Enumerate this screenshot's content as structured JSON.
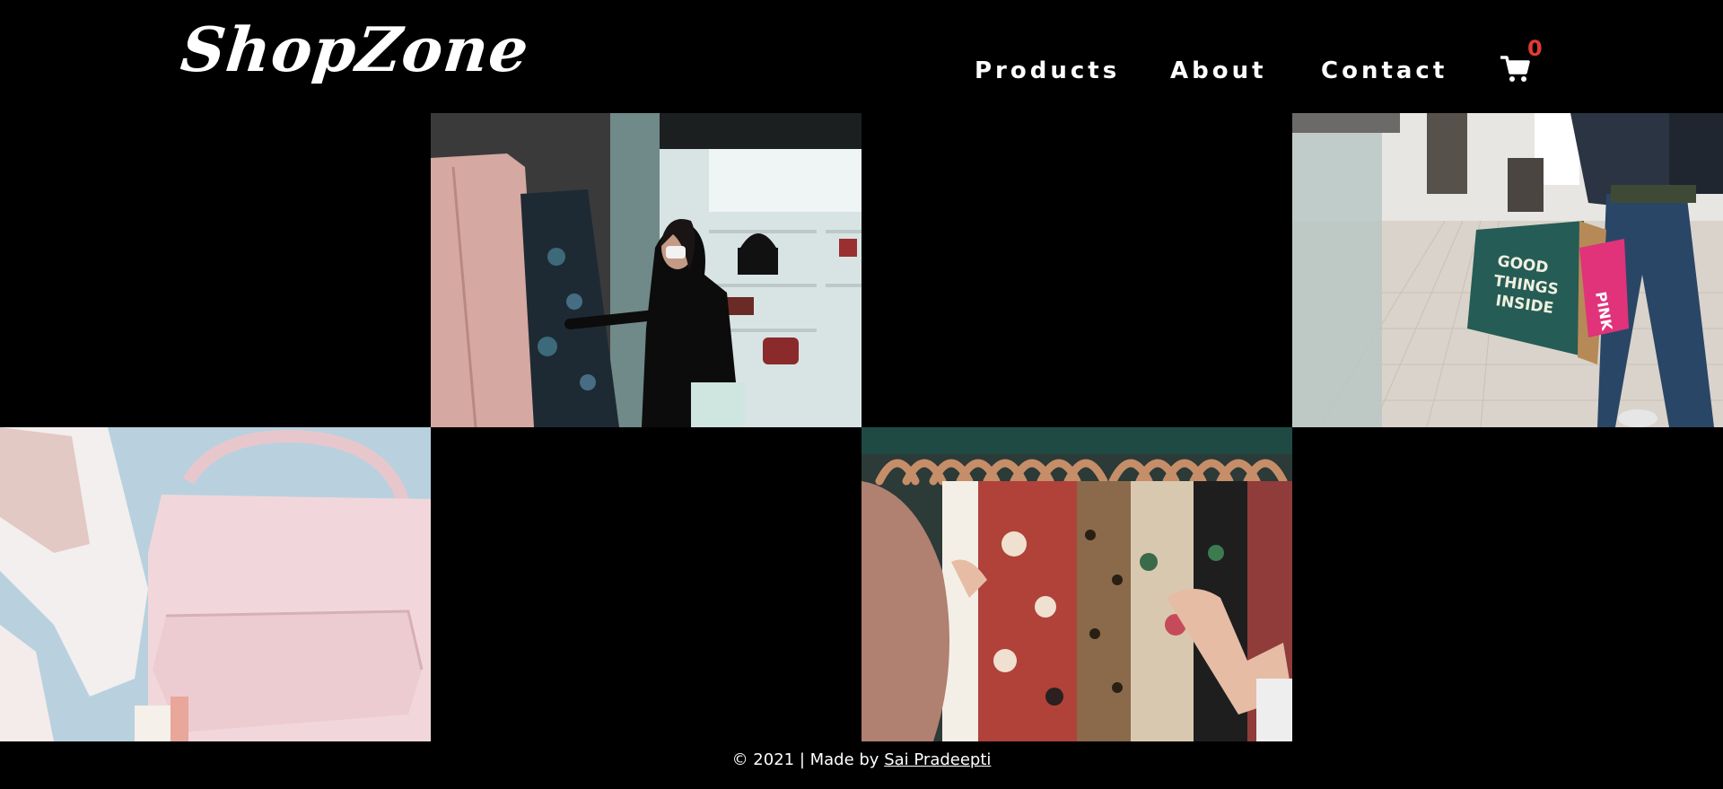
{
  "brand": {
    "logo_text": "ShopZone"
  },
  "nav": {
    "items": [
      {
        "label": "Products"
      },
      {
        "label": "About"
      },
      {
        "label": "Contact"
      }
    ],
    "cart": {
      "icon": "cart-icon",
      "count": "0",
      "count_color": "#e03c31"
    }
  },
  "gallery": {
    "tiles": [
      {
        "name": "store-clothing-rack-photo",
        "position": "row1-col2"
      },
      {
        "name": "shopping-bags-walking-photo",
        "position": "row1-col4",
        "bag_text": "GOOD THINGS INSIDE",
        "pink_bag_text": "PINK"
      },
      {
        "name": "pink-handbag-shoe-photo",
        "position": "row2-col1"
      },
      {
        "name": "hangers-clothes-photo",
        "position": "row2-col3"
      }
    ]
  },
  "footer": {
    "prefix": "© 2021 | Made by",
    "author_link": "Sai Pradeepti"
  }
}
